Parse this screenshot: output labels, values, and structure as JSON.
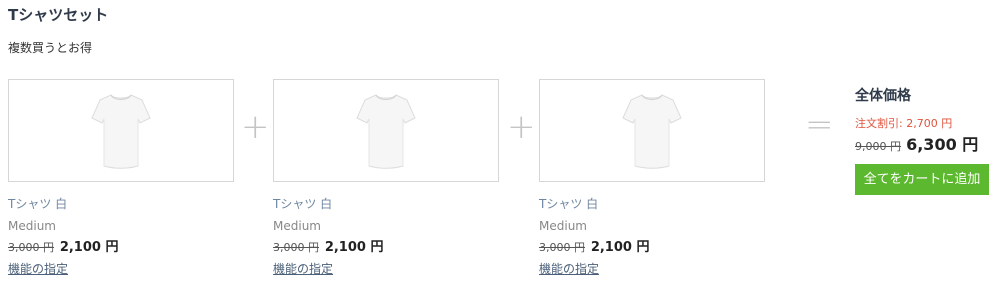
{
  "bundle": {
    "title": "Tシャツセット",
    "subtitle": "複数買うとお得"
  },
  "products": [
    {
      "name": "Tシャツ 白",
      "variant": "Medium",
      "old_price": "3,000 円",
      "new_price": "2,100 円",
      "options_link": "機能の指定",
      "image_icon": "white-tshirt"
    },
    {
      "name": "Tシャツ 白",
      "variant": "Medium",
      "old_price": "3,000 円",
      "new_price": "2,100 円",
      "options_link": "機能の指定",
      "image_icon": "white-tshirt"
    },
    {
      "name": "Tシャツ 白",
      "variant": "Medium",
      "old_price": "3,000 円",
      "new_price": "2,100 円",
      "options_link": "機能の指定",
      "image_icon": "white-tshirt"
    }
  ],
  "operators": {
    "plus": "+",
    "equals": "="
  },
  "summary": {
    "heading": "全体価格",
    "discount": "注文割引: 2,700 円",
    "old_total": "9,000 円",
    "new_total": "6,300 円",
    "cart_button": "全てをカートに追加"
  },
  "colors": {
    "accent_green": "#5cb82e",
    "discount_red": "#e0533c",
    "link_blue": "#4a5f78"
  }
}
